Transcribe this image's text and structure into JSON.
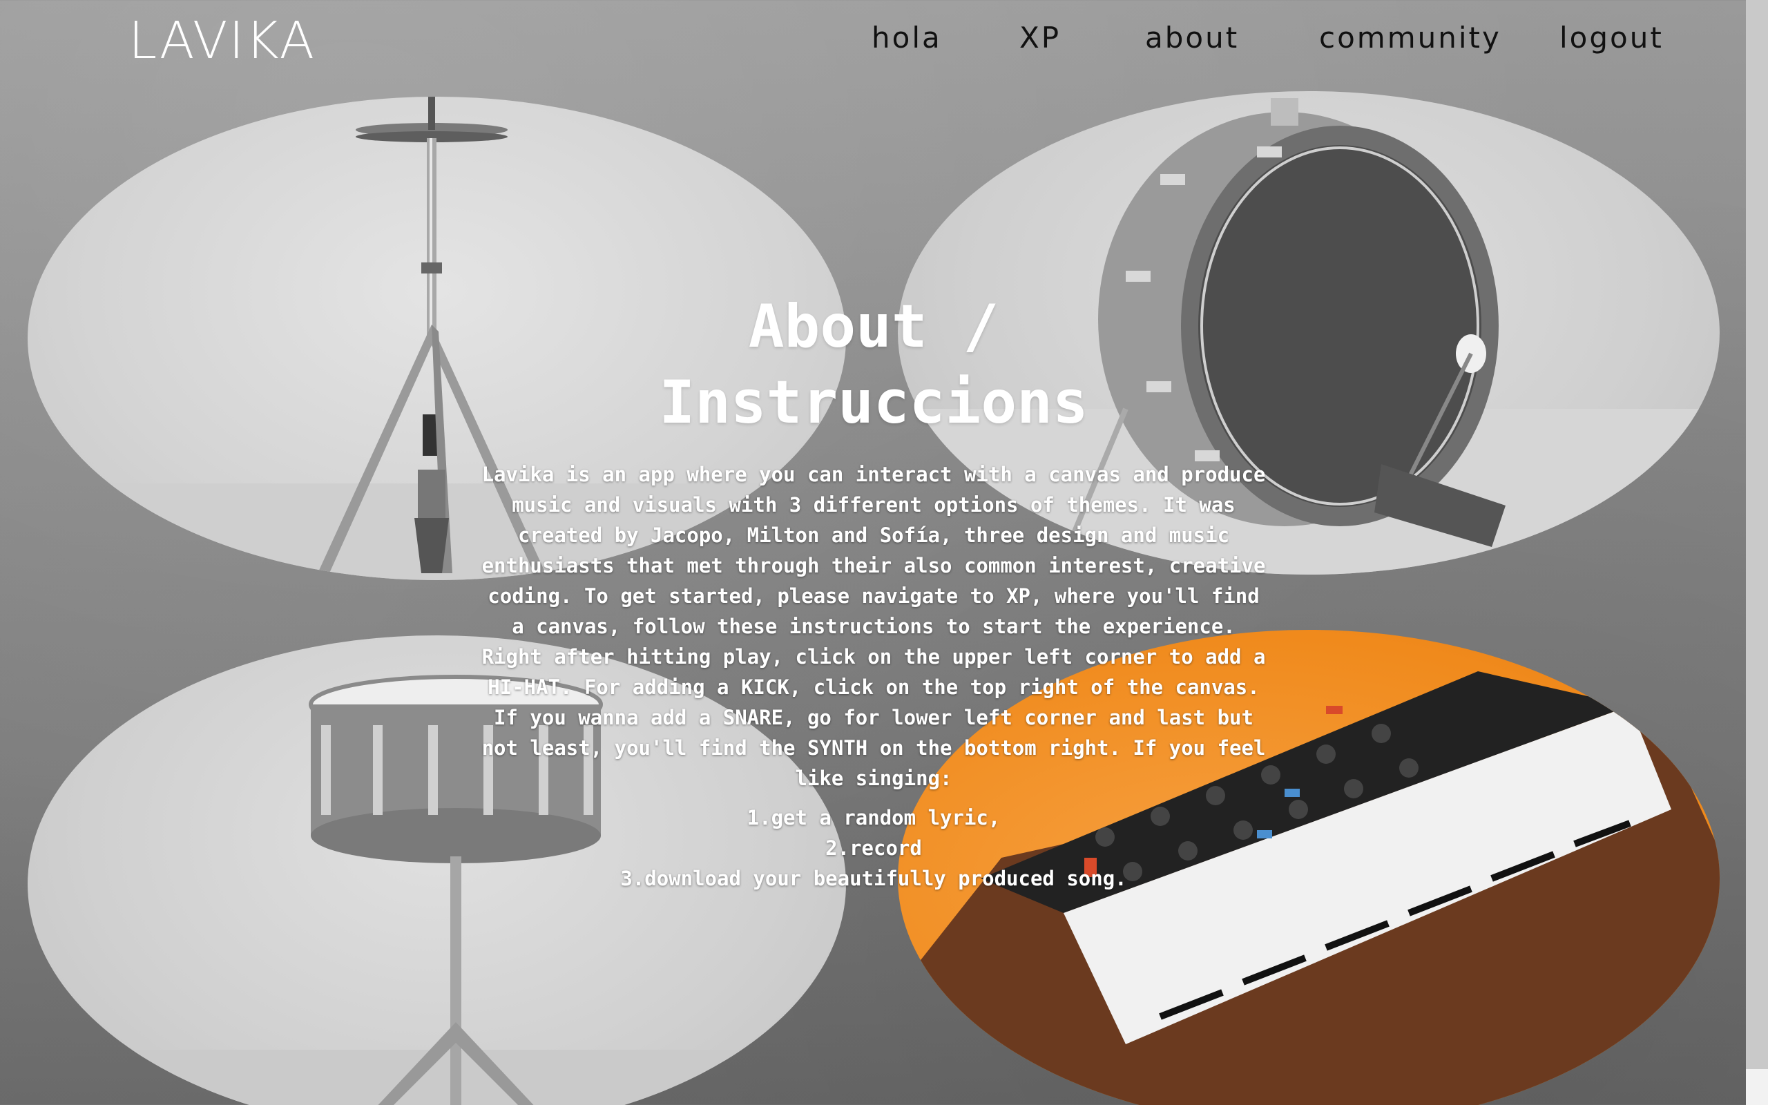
{
  "header": {
    "logo": "LAVIKA",
    "nav": [
      {
        "label": "hola"
      },
      {
        "label": "XP"
      },
      {
        "label": "about"
      },
      {
        "label": "community"
      },
      {
        "label": "logout"
      }
    ]
  },
  "main": {
    "title_line1": "About /",
    "title_line2": "Instruccions",
    "description": "Lavika is an app where you can interact with a canvas and produce music and visuals with 3 different options of themes. It was created by Jacopo, Milton and Sofía, three design and music enthusiasts that met through their also common interest, creative coding. To get started, please navigate to XP, where you'll find a canvas, follow these instructions to start the experience. Right after hitting play, click on the upper left corner to add a HI-HAT. For adding a KICK, click on the top right of the canvas. If you wanna add a SNARE, go for lower left corner and last but not least, you'll find the SYNTH on the bottom right. If you feel like singing:",
    "steps": [
      "1.get a random lyric,",
      "2.record",
      "3.download your beautifully produced song."
    ]
  },
  "images": {
    "top_left": "hi-hat-stand-photo",
    "top_right": "kick-drum-photo",
    "bottom_left": "snare-drum-photo",
    "bottom_right": "analog-synthesizer-photo"
  },
  "colors": {
    "background": "#8a8a8a",
    "text": "#ffffff",
    "nav_text": "#111111",
    "synth_accent": "#f08a1c"
  }
}
